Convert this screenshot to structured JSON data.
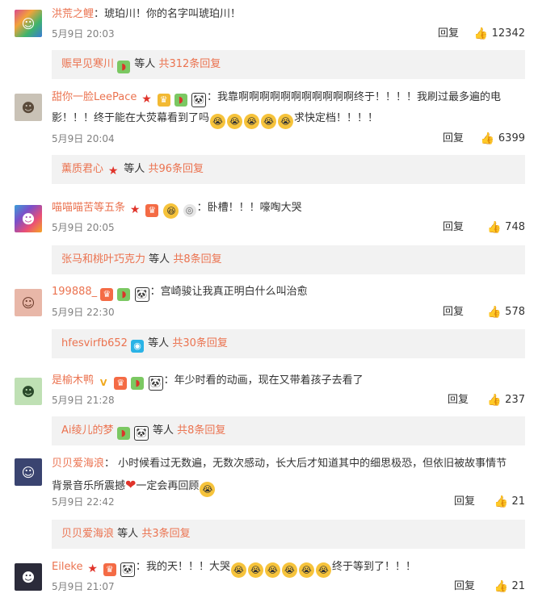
{
  "comments": [
    {
      "username": "洪荒之鲤",
      "text": "琥珀川！你的名字叫琥珀川！",
      "time": "5月9日 20:03",
      "reply": "回复",
      "likes": "12342",
      "sub": {
        "user": "赈早见寒川",
        "mid": "等人",
        "count": "共312条回复"
      }
    },
    {
      "username": "甜你一脸LeePace",
      "text_line1": "我靠啊啊啊啊啊啊啊啊啊啊啊终于！！！！我刷过最多遍的电",
      "text_line2a": "影！！！终于能在大荧幕看到了吗",
      "text_line2b": "求快定档！！！！",
      "time": "5月9日 20:04",
      "reply": "回复",
      "likes": "6399",
      "sub": {
        "user": "薰质君心",
        "mid": "等人",
        "count": "共96条回复"
      }
    },
    {
      "username": "喵喵喵苦等五条",
      "text": "卧槽！！！嚎啕大哭",
      "time": "5月9日 20:05",
      "reply": "回复",
      "likes": "748",
      "sub": {
        "user": "张马和桃叶巧克力",
        "mid": "等人",
        "count": "共8条回复"
      }
    },
    {
      "username": "199888_",
      "text": "宫崎骏让我真正明白什么叫治愈",
      "time": "5月9日 22:30",
      "reply": "回复",
      "likes": "578",
      "sub": {
        "user": "hfesvirfb652",
        "mid": "等人",
        "count": "共30条回复"
      }
    },
    {
      "username": "是榆木鸭",
      "text": "年少时看的动画，现在又带着孩子去看了",
      "time": "5月9日 21:28",
      "reply": "回复",
      "likes": "237",
      "sub": {
        "user": "Ai绫儿的梦",
        "mid": "等人",
        "count": "共8条回复"
      }
    },
    {
      "username": "贝贝爱海浪",
      "text_line1": "小时候看过无数遍，无数次感动，长大后才知道其中的细思极恐，但依旧被故事情节",
      "text_line2a": "背景音乐所震撼",
      "text_line2b": "一定会再回顾",
      "time": "5月9日 22:42",
      "reply": "回复",
      "likes": "21",
      "sub": {
        "user": "贝贝爱海浪",
        "mid": "等人",
        "count": "共3条回复"
      }
    },
    {
      "username": "Eileke",
      "text_a": "我的天！！！大哭",
      "text_b": "终于等到了！！！",
      "time": "5月9日 21:07",
      "reply": "回复",
      "likes": "21"
    }
  ],
  "icons": {
    "like": "thumbs-up-icon",
    "badge_star": "star-badge-icon",
    "badge_watermelon": "watermelon-badge-icon",
    "badge_panda": "panda-badge-icon",
    "emoji_cry": "crying-emoji-icon"
  },
  "colors": {
    "username": "#eb7350",
    "subbar_bg": "#f2f2f2",
    "meta_text": "#808080"
  }
}
